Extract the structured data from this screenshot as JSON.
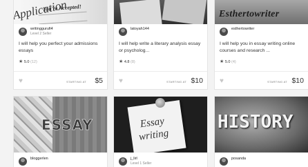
{
  "gigs": [
    {
      "thumb_text": [
        "Application",
        "You're Accepted!"
      ],
      "username": "writinggurufi4",
      "level": "Level 2 Seller",
      "title": "I will help you perfect your admissions essays",
      "rating": "5.0",
      "reviews": "(12)",
      "starting_label": "STARTING AT",
      "price": "$5"
    },
    {
      "username": "latoyah144",
      "level": "",
      "title": "I will help write a literary analysis essay or psycholog...",
      "rating": "4.8",
      "reviews": "(8)",
      "starting_label": "STARTING AT",
      "price": "$10"
    },
    {
      "thumb_text": [
        "Esthertowriter"
      ],
      "username": "esthertowriter",
      "level": "",
      "title": "I will help you in essay writing online courses and research ...",
      "rating": "5.0",
      "reviews": "(4)",
      "starting_label": "STARTING AT",
      "price": "$10"
    },
    {
      "thumb_text": [
        "ESSAY"
      ],
      "username": "bloggerlen",
      "level": ""
    },
    {
      "thumb_text": [
        "Essay",
        "writing"
      ],
      "username": "j_lirl",
      "level": "Level 1 Seller"
    },
    {
      "thumb_text": [
        "HISTORY"
      ],
      "username": "posanda",
      "level": ""
    }
  ],
  "icons": {
    "star": "star-icon",
    "heart": "heart-icon",
    "avatar": "avatar"
  }
}
